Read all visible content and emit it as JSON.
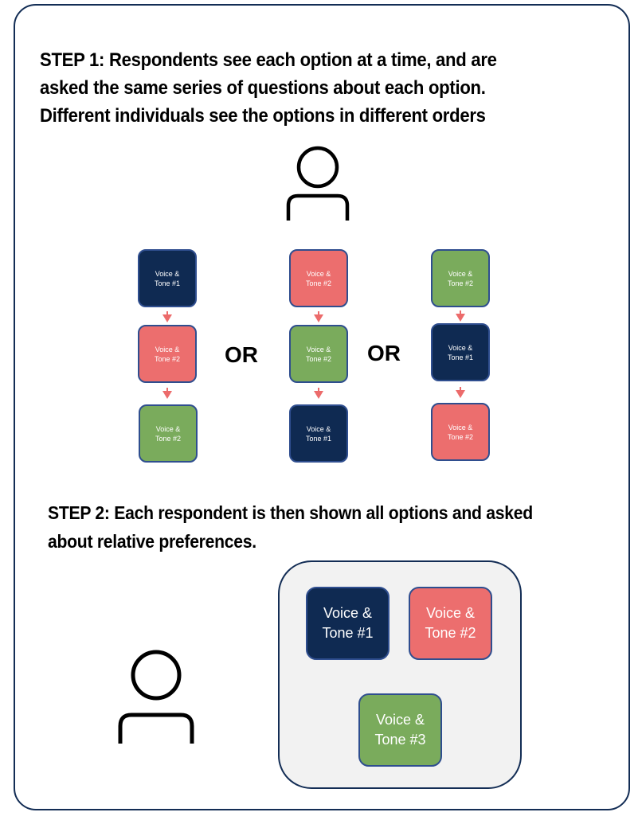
{
  "colors": {
    "frame_border": "#132d55",
    "navy": "#0f2a52",
    "coral": "#ec6e6e",
    "green": "#7aab5c",
    "box_border": "#2f4e8f",
    "arrow": "#ec6b6b",
    "container_bg": "#f2f2f2"
  },
  "step1": {
    "heading": "STEP 1: Respondents see each option at a time, and are\nasked the same series of questions about each option.\nDifferent individuals see the options in different orders",
    "person_icon": "person-icon",
    "separator_label": "OR",
    "sequences": [
      {
        "name": "order-a",
        "options": [
          {
            "label": "Voice &\nTone #1",
            "color": "navy"
          },
          {
            "label": "Voice &\nTone #2",
            "color": "coral"
          },
          {
            "label": "Voice &\nTone #2",
            "color": "green"
          }
        ]
      },
      {
        "name": "order-b",
        "options": [
          {
            "label": "Voice &\nTone #2",
            "color": "coral"
          },
          {
            "label": "Voice &\nTone #2",
            "color": "green"
          },
          {
            "label": "Voice &\nTone #1",
            "color": "navy"
          }
        ]
      },
      {
        "name": "order-c",
        "options": [
          {
            "label": "Voice &\nTone #2",
            "color": "green"
          },
          {
            "label": "Voice &\nTone #1",
            "color": "navy"
          },
          {
            "label": "Voice &\nTone #2",
            "color": "coral"
          }
        ]
      }
    ]
  },
  "step2": {
    "heading": "STEP 2: Each respondent is then shown all options and asked\nabout relative preferences.",
    "person_icon": "person-icon",
    "options": [
      {
        "label": "Voice &\nTone #1",
        "color": "navy"
      },
      {
        "label": "Voice &\nTone #2",
        "color": "coral"
      },
      {
        "label": "Voice &\nTone #3",
        "color": "green"
      }
    ]
  }
}
